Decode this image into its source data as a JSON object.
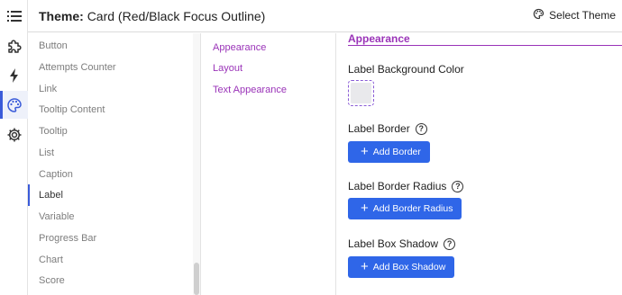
{
  "header": {
    "title_prefix": "Theme:",
    "title_value": "Card (Red/Black Focus Outline)",
    "select_theme_label": "Select Theme"
  },
  "rail": {
    "items": [
      {
        "icon": "menu-icon",
        "active": false
      },
      {
        "icon": "puzzle-icon",
        "active": false
      },
      {
        "icon": "bolt-icon",
        "active": false
      },
      {
        "icon": "palette-icon",
        "active": true
      },
      {
        "icon": "gear-icon",
        "active": false
      }
    ]
  },
  "components": {
    "items": [
      "Button",
      "Attempts Counter",
      "Link",
      "Tooltip Content",
      "Tooltip",
      "List",
      "Caption",
      "Label",
      "Variable",
      "Progress Bar",
      "Chart",
      "Score"
    ],
    "active": "Label"
  },
  "sections": {
    "items": [
      "Appearance",
      "Layout",
      "Text Appearance"
    ]
  },
  "main": {
    "heading": "Appearance",
    "bg_color_label": "Label Background Color",
    "bg_color_value": "#e9e9ec",
    "border_label": "Label Border",
    "add_border": "Add Border",
    "radius_label": "Label Border Radius",
    "add_radius": "Add Border Radius",
    "shadow_label": "Label Box Shadow",
    "add_shadow": "Add Box Shadow"
  },
  "colors": {
    "accent": "#9a33b8",
    "primary_button": "#2f66e8",
    "active_indicator": "#3a5bd9"
  }
}
